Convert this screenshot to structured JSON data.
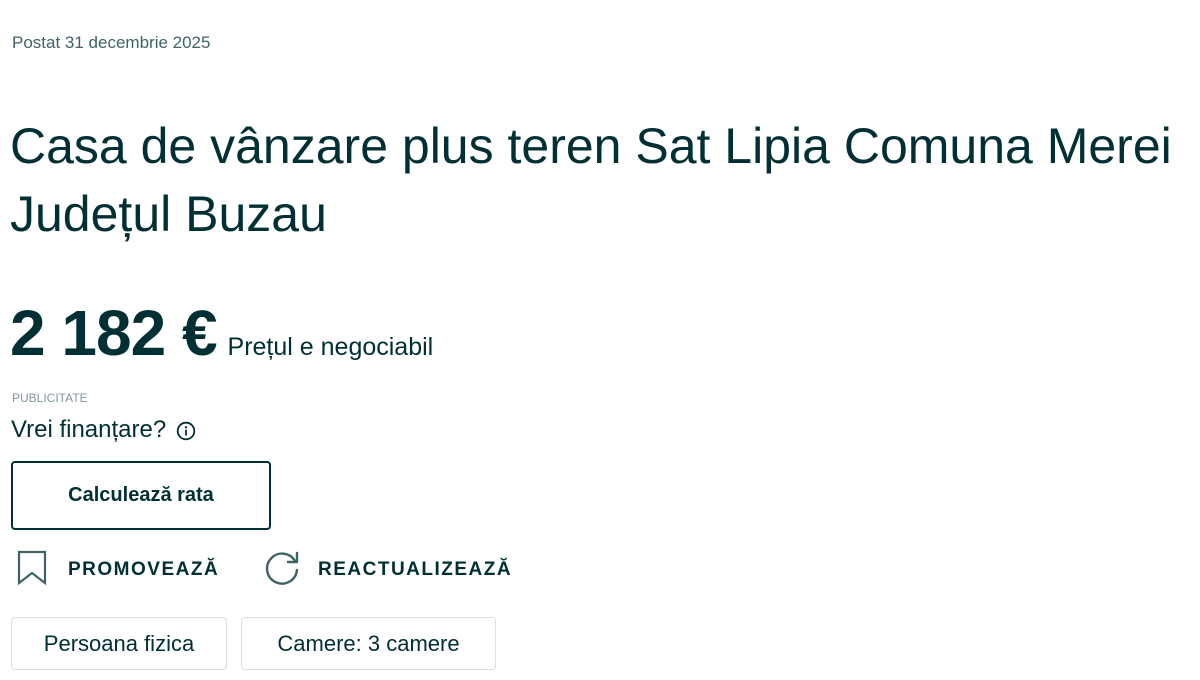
{
  "posted_date": "Postat 31 decembrie 2025",
  "title": "Casa de vânzare plus teren Sat Lipia Comuna Merei\nJudețul Buzau",
  "price": {
    "value": "2 182 €",
    "negotiable_label": "Prețul e negociabil"
  },
  "ad_label": "PUBLICITATE",
  "financing": {
    "question": "Vrei finanțare?",
    "info_icon": "info-circle-icon",
    "calculate_button": "Calculează rata"
  },
  "actions": {
    "promote": {
      "label": "PROMOVEAZĂ",
      "icon": "bookmark-icon"
    },
    "refresh": {
      "label": "REACTUALIZEAZĂ",
      "icon": "refresh-icon"
    }
  },
  "tags": [
    {
      "label": "Persoana fizica"
    },
    {
      "label": "Camere: 3 camere"
    }
  ],
  "colors": {
    "text_primary": "#002f34",
    "text_secondary": "#406367",
    "border_light": "#d8dfe0"
  }
}
